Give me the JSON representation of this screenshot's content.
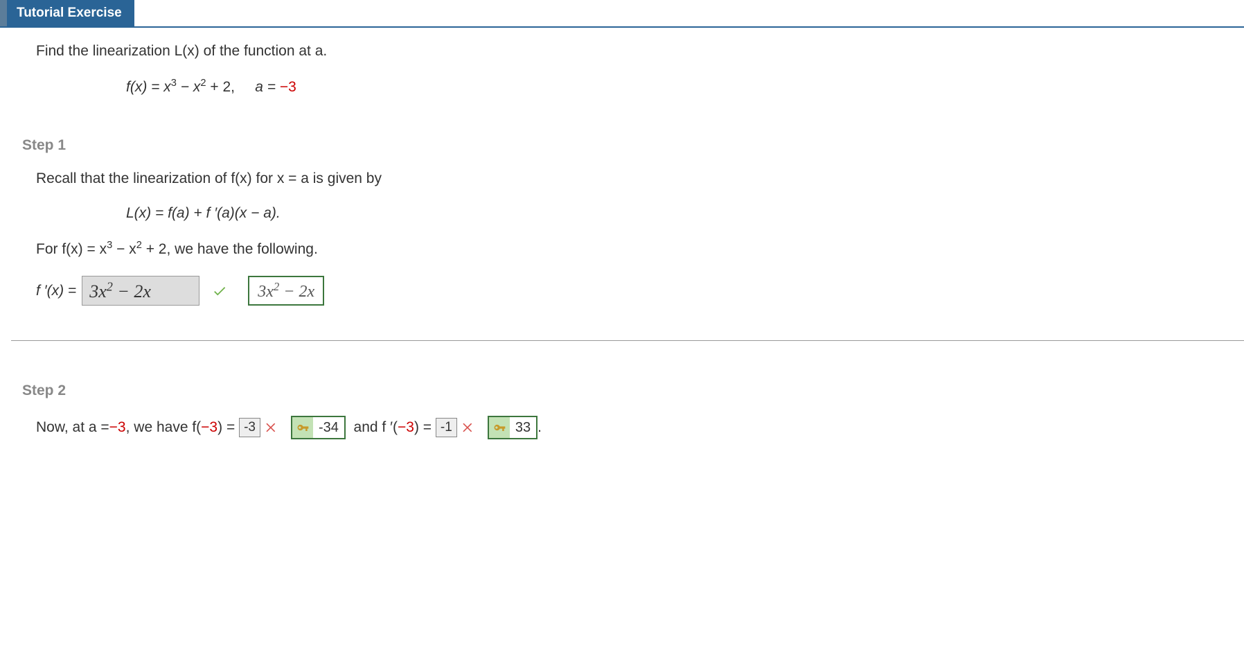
{
  "header": {
    "title": "Tutorial Exercise"
  },
  "problem": {
    "prompt": "Find the linearization L(x) of the function at a.",
    "func_prefix": "f(x) = x",
    "exp3": "3",
    "minus_x": " − x",
    "exp2": "2",
    "plus_const": " + 2,",
    "a_prefix": "a = ",
    "a_value": "−3"
  },
  "step1": {
    "heading": "Step 1",
    "recall": "Recall that the linearization of f(x) for x = a is given by",
    "formula": "L(x) = f(a) + f ′(a)(x − a).",
    "for_fx_prefix": "For f(x) = x",
    "for_fx_mid": " − x",
    "for_fx_tail": " + 2, we have the following.",
    "fprime_label": "f ′(x) = ",
    "user_answer": "3x² − 2x",
    "correct_answer": "3x² − 2x"
  },
  "step2": {
    "heading": "Step 2",
    "now_text_1": "Now, at a = ",
    "a_val": "−3",
    "now_text_2": ", we have f(",
    "arg1": "−3",
    "now_text_3": ") = ",
    "user_fa": "-3",
    "key_fa": "-34",
    "and_text_1": "  and f ′(",
    "arg2": "−3",
    "and_text_2": ") = ",
    "user_fpa": "-1",
    "key_fpa": "33",
    "period": " ."
  }
}
